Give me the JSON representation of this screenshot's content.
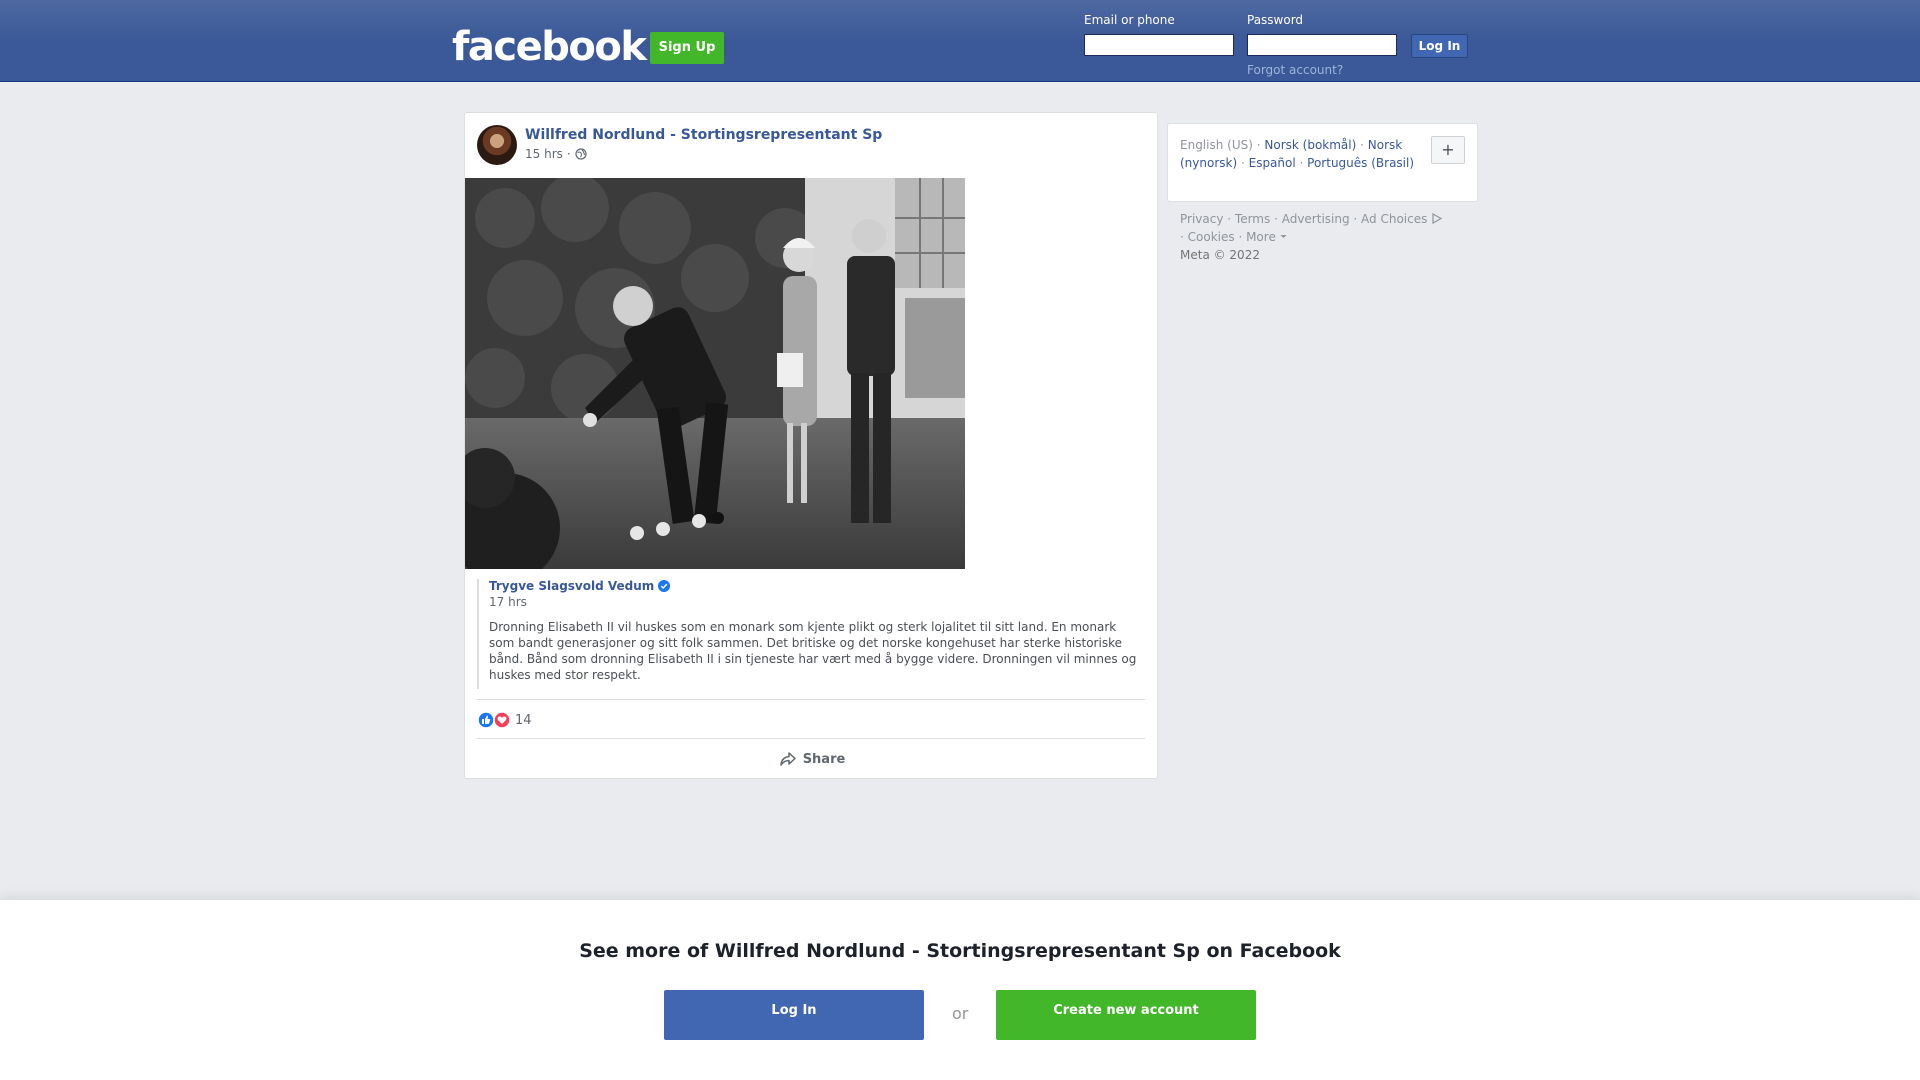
{
  "header": {
    "logo": "facebook",
    "signup_label": "Sign Up",
    "email_label": "Email or phone",
    "password_label": "Password",
    "login_label": "Log In",
    "forgot_label": "Forgot account?"
  },
  "post": {
    "author": "Willfred Nordlund - Stortingsrepresentant Sp",
    "time": "15 hrs",
    "audience_icon": "globe-icon",
    "quote": {
      "author": "Trygve Slagsvold Vedum",
      "time": "17 hrs",
      "text": "Dronning Elisabeth II vil huskes som en monark som kjente plikt og sterk lojalitet til sitt land. En monark som bandt generasjoner og sitt folk sammen. Det britiske og det norske kongehuset har sterke historiske bånd. Bånd som dronning Elisabeth II i sin tjeneste har vært med å bygge videre. Dronningen vil minnes og huskes med stor respekt."
    },
    "reaction_count": "14",
    "share_label": "Share"
  },
  "languages": {
    "current": "English (US)",
    "items": [
      "Norsk (bokmål)",
      "Norsk (nynorsk)",
      "Español",
      "Português (Brasil)"
    ],
    "more_label": "+"
  },
  "footer": {
    "links": [
      "Privacy",
      "Terms",
      "Advertising",
      "Ad Choices",
      "Cookies",
      "More"
    ],
    "copyright": "Meta © 2022"
  },
  "banner": {
    "title": "See more of Willfred Nordlund - Stortingsrepresentant Sp on Facebook",
    "login_label": "Log In",
    "or_label": "or",
    "create_label": "Create new account"
  },
  "colors": {
    "brand_blue": "#3b5998",
    "green": "#42b72a",
    "link": "#385898"
  }
}
